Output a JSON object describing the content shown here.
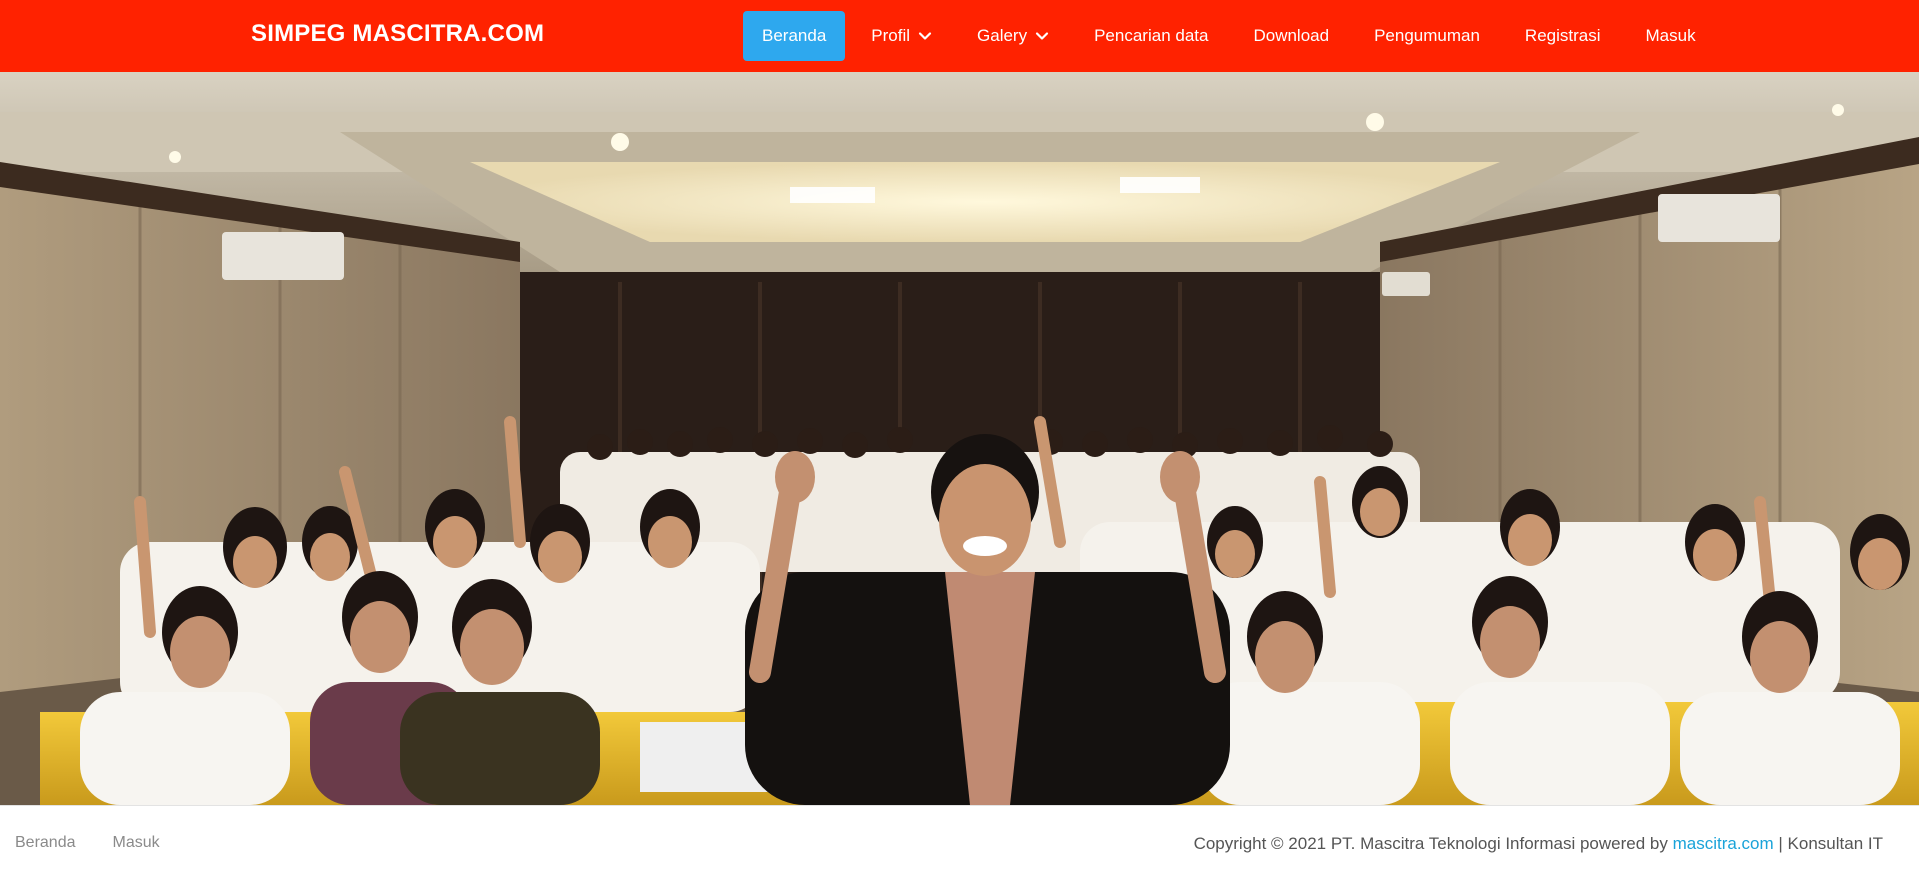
{
  "brand": {
    "title": "SIMPEG MASCITRA.COM"
  },
  "nav": {
    "items": [
      {
        "label": "Beranda",
        "active": true
      },
      {
        "label": "Profil",
        "has_dropdown": true
      },
      {
        "label": "Galery",
        "has_dropdown": true
      },
      {
        "label": "Pencarian data"
      },
      {
        "label": "Download"
      },
      {
        "label": "Pengumuman"
      },
      {
        "label": "Registrasi"
      },
      {
        "label": "Masuk"
      }
    ]
  },
  "hero": {
    "image": "group-photo-training-room"
  },
  "footer": {
    "links": [
      "Beranda",
      "Masuk"
    ],
    "copyright_prefix": "Copyright © 2021 PT. Mascitra Teknologi Informasi powered by",
    "copyright_link": "mascitra.com",
    "copyright_suffix": "| Konsultan IT"
  },
  "colors": {
    "navbar": "#ff2200",
    "active_nav": "#2ea8ee",
    "link": "#1aa3d9"
  }
}
